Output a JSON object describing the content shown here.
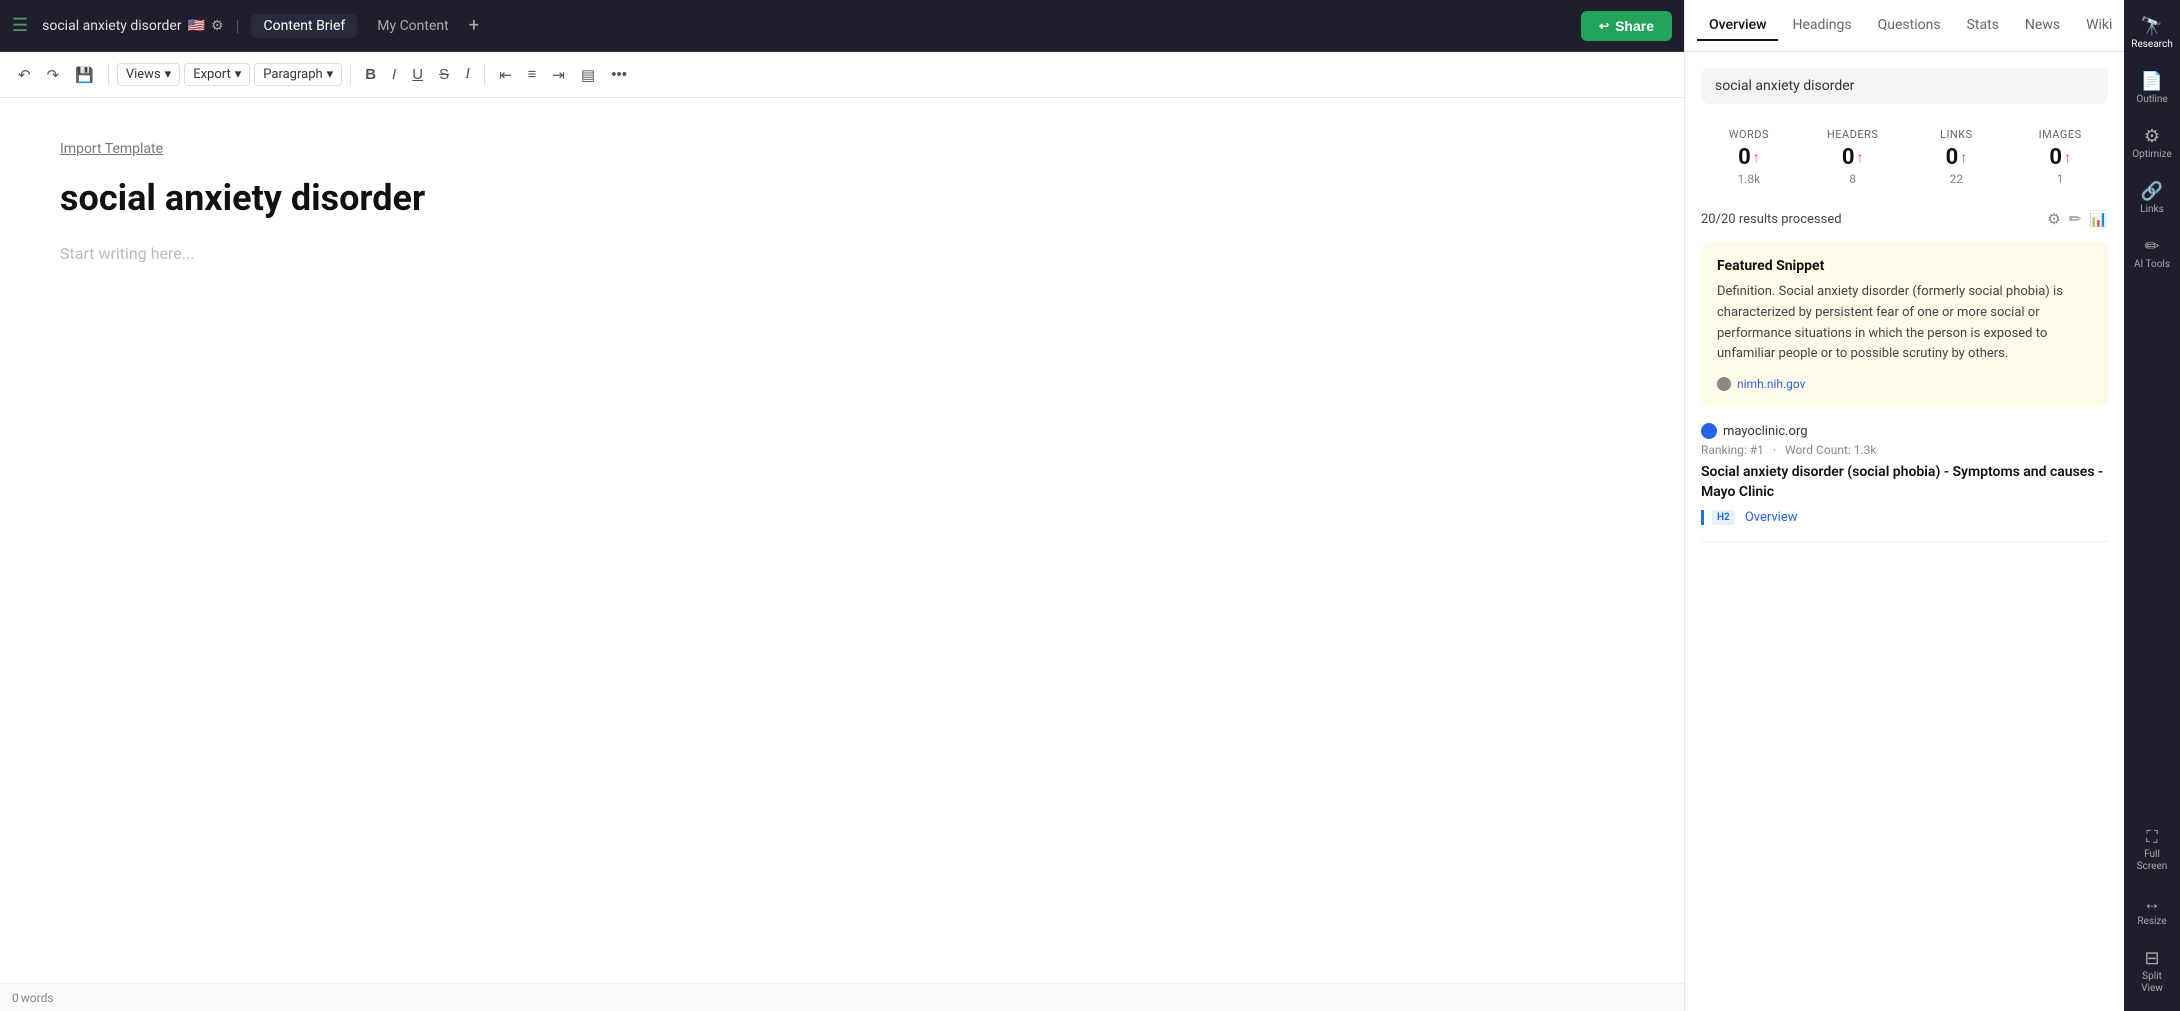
{
  "topbar": {
    "doc_title": "social anxiety disorder",
    "flag": "🇺🇸",
    "tabs": [
      {
        "label": "Content Brief",
        "active": true
      },
      {
        "label": "My Content",
        "active": false
      }
    ],
    "share_button": "Share"
  },
  "toolbar": {
    "views_label": "Views",
    "export_label": "Export",
    "paragraph_label": "Paragraph"
  },
  "editor": {
    "import_link": "Import Template",
    "heading": "social anxiety disorder",
    "placeholder": "Start writing here..."
  },
  "status_bar": {
    "words": "0",
    "words_label": "words"
  },
  "research_panel": {
    "tabs": [
      {
        "label": "Overview",
        "active": true
      },
      {
        "label": "Headings",
        "active": false
      },
      {
        "label": "Questions",
        "active": false
      },
      {
        "label": "Stats",
        "active": false
      },
      {
        "label": "News",
        "active": false
      },
      {
        "label": "Wiki",
        "active": false
      }
    ],
    "search_query": "social anxiety disorder",
    "stats": [
      {
        "label": "WORDS",
        "value": "0",
        "arrow": "↑",
        "sub": "1.8k"
      },
      {
        "label": "HEADERS",
        "value": "0",
        "arrow": "↑",
        "sub": "8"
      },
      {
        "label": "LINKS",
        "value": "0",
        "arrow": "↑",
        "sub": "22"
      },
      {
        "label": "IMAGES",
        "value": "0",
        "arrow": "↑",
        "sub": "1"
      }
    ],
    "results_processed": "20/20 results processed",
    "featured_snippet": {
      "title": "Featured Snippet",
      "text": "Definition. Social anxiety disorder (formerly social phobia) is characterized by persistent fear of one or more social or performance situations in which the person is exposed to unfamiliar people or to possible scrutiny by others.",
      "source": "nimh.nih.gov"
    },
    "results": [
      {
        "domain": "mayoclinic.org",
        "ranking": "Ranking: #1",
        "word_count": "Word Count: 1.3k",
        "title": "Social anxiety disorder (social phobia) - Symptoms and causes - Mayo Clinic",
        "h2_badge": "H2",
        "link_text": "Overview"
      }
    ]
  },
  "sidebar": {
    "items": [
      {
        "icon": "🔭",
        "label": "Research",
        "active": true
      },
      {
        "icon": "📄",
        "label": "Outline",
        "active": false
      },
      {
        "icon": "⚙",
        "label": "Optimize",
        "active": false
      },
      {
        "icon": "🔗",
        "label": "Links",
        "active": false
      },
      {
        "icon": "✏",
        "label": "AI Tools",
        "active": false
      },
      {
        "icon": "⛶",
        "label": "Full Screen",
        "active": false
      },
      {
        "icon": "↔",
        "label": "Resize",
        "active": false
      },
      {
        "icon": "⊟",
        "label": "Split View",
        "active": false
      }
    ]
  }
}
